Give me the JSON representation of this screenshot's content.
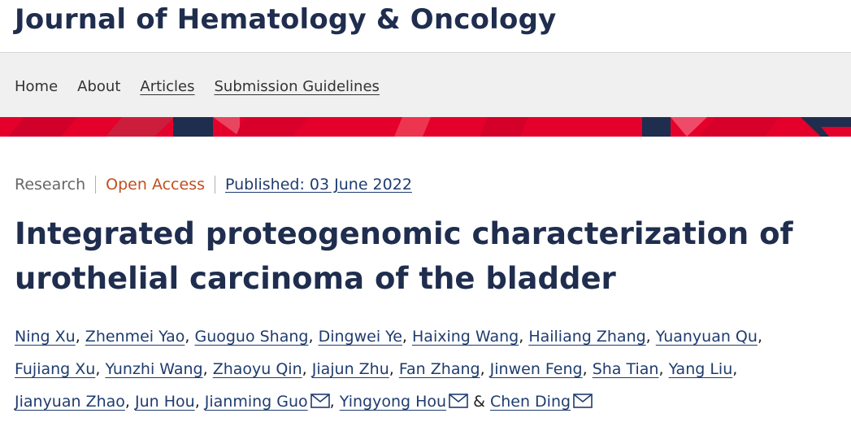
{
  "journal": {
    "title": "Journal of Hematology & Oncology"
  },
  "nav": {
    "items": [
      {
        "label": "Home"
      },
      {
        "label": "About"
      },
      {
        "label": "Articles"
      },
      {
        "label": "Submission Guidelines"
      }
    ]
  },
  "colors": {
    "brand_red": "#e4002b",
    "brand_navy": "#1f2d4e",
    "link": "#1f3c6e",
    "open_access": "#c0501e"
  },
  "article": {
    "type": "Research",
    "access": "Open Access",
    "published": "Published: 03 June 2022",
    "title": "Integrated proteogenomic characterization of urothelial carcinoma of the bladder",
    "authors": [
      "Ning Xu",
      "Zhenmei Yao",
      "Guoguo Shang",
      "Dingwei Ye",
      "Haixing Wang",
      "Hailiang Zhang",
      "Yuanyuan Qu",
      "Fujiang Xu",
      "Yunzhi Wang",
      "Zhaoyu Qin",
      "Jiajun Zhu",
      "Fan Zhang",
      "Jinwen Feng",
      "Sha Tian",
      "Yang Liu",
      "Jianyuan Zhao",
      "Jun Hou",
      "Jianming Guo",
      "Yingyong Hou",
      "Chen Ding"
    ],
    "separator": ",",
    "conjunction": "&",
    "corresponding_icon": "envelope-icon"
  }
}
